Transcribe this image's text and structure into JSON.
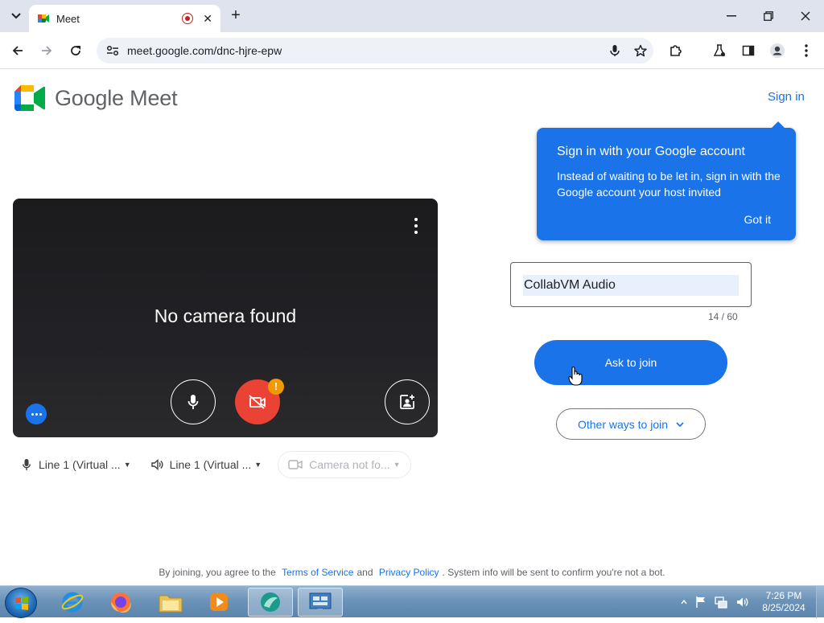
{
  "browser": {
    "tab_title": "Meet",
    "url": "meet.google.com/dnc-hjre-epw",
    "new_tab_symbol": "+"
  },
  "page": {
    "logo_text": "Google Meet",
    "sign_in": "Sign in",
    "preview": {
      "message": "No camera found",
      "warning_symbol": "!"
    },
    "devices": {
      "microphone": "Line 1 (Virtual ...",
      "speaker": "Line 1 (Virtual ...",
      "camera": "Camera not fo..."
    },
    "tooltip": {
      "title": "Sign in with your Google account",
      "body": "Instead of waiting to be let in, sign in with the Google account your host invited",
      "action": "Got it"
    },
    "name_input": {
      "value": "CollabVM Audio",
      "counter": "14 / 60"
    },
    "ask_to_join": "Ask to join",
    "other_ways": "Other ways to join",
    "footer": {
      "prefix": "By joining, you agree to the",
      "terms": "Terms of Service",
      "and": "and",
      "privacy": "Privacy Policy",
      "suffix": ". System info will be sent to confirm you're not a bot."
    }
  },
  "taskbar": {
    "time": "7:26 PM",
    "date": "8/25/2024"
  },
  "colors": {
    "accent": "#1a73e8",
    "danger": "#ea4335",
    "warning": "#f29900"
  }
}
